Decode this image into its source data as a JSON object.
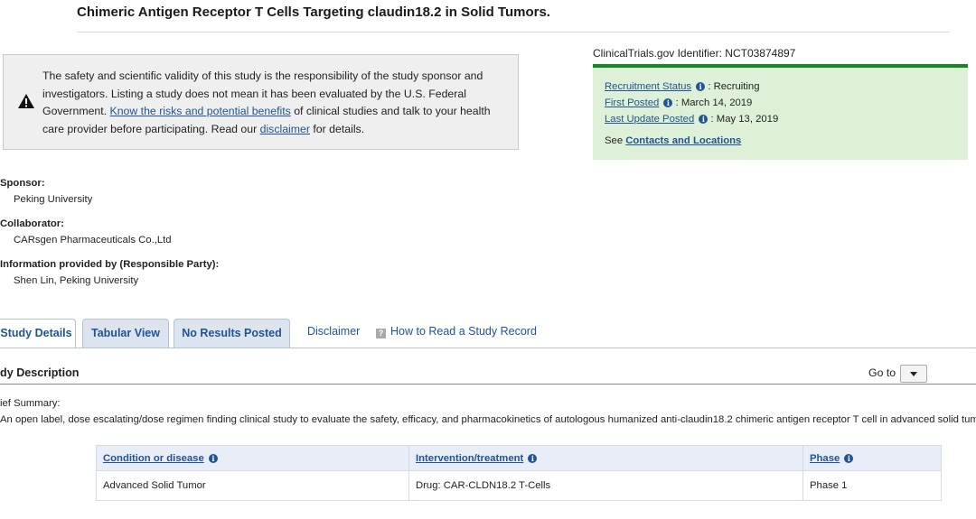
{
  "title": "Chimeric Antigen Receptor T Cells Targeting claudin18.2 in Solid Tumors.",
  "disclaimer": {
    "text_1": "The safety and scientific validity of this study is the responsibility of the study sponsor and investigators. Listing a study does not mean it has been evaluated by the U.S. Federal Government. ",
    "link_risks": "Know the risks and potential benefits",
    "text_2": " of clinical studies and talk to your health care provider before participating. Read our ",
    "link_disclaimer": "disclaimer",
    "text_3": " for details."
  },
  "identifier": {
    "label": "ClinicalTrials.gov Identifier: ",
    "value": "NCT03874897"
  },
  "status": {
    "recruitment_label": "Recruitment Status",
    "recruitment_value": " : Recruiting",
    "first_posted_label": "First Posted",
    "first_posted_value": " : March 14, 2019",
    "last_update_label": "Last Update Posted",
    "last_update_value": " : May 13, 2019",
    "see": "See ",
    "contacts_link": "Contacts and Locations"
  },
  "sponsor": {
    "label": "Sponsor:",
    "value": "Peking University"
  },
  "collaborator": {
    "label": "Collaborator:",
    "value": "CARsgen Pharmaceuticals Co.,Ltd"
  },
  "responsible": {
    "label": "Information provided by (Responsible Party):",
    "value": "Shen Lin, Peking University"
  },
  "tabs": {
    "study_details": "Study Details",
    "tabular_view": "Tabular View",
    "no_results": "No Results Posted",
    "disclaimer": "Disclaimer",
    "how_to_read": "How to Read a Study Record"
  },
  "section": {
    "title": "dy Description",
    "goto": "Go to"
  },
  "brief_summary": {
    "label": "ief Summary:",
    "text": "An open label, dose escalating/dose regimen finding clinical study to evaluate the safety, efficacy, and pharmacokinetics of autologous humanized anti-claudin18.2 chimeric antigen receptor T cell in advanced solid tum"
  },
  "table": {
    "headers": [
      "Condition or disease",
      "Intervention/treatment",
      "Phase"
    ],
    "rows": [
      [
        "Advanced Solid Tumor",
        "Drug: CAR-CLDN18.2 T-Cells",
        "Phase 1"
      ]
    ]
  },
  "colors": {
    "link": "#205493",
    "status_bg": "#dff0d8",
    "status_border": "#138a1d",
    "disclaimer_bg": "#efefef"
  },
  "icons": {
    "warning": "warning-icon",
    "info": "info-icon",
    "help": "help-icon",
    "dropdown": "chevron-down-icon"
  }
}
